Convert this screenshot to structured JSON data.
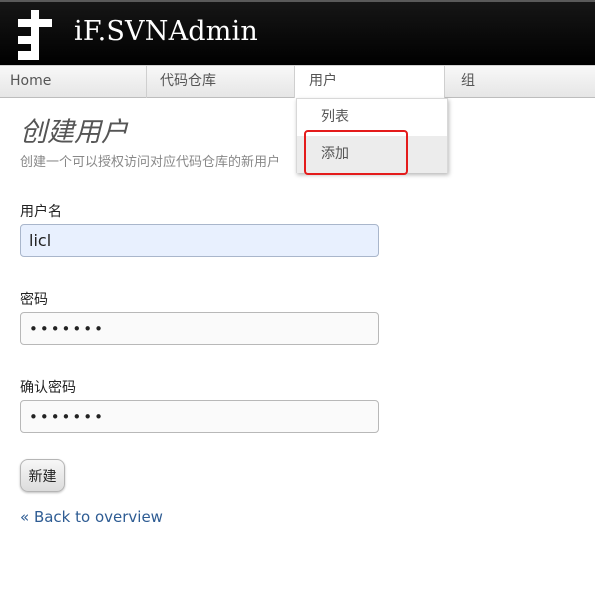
{
  "header": {
    "title": "iF.SVNAdmin",
    "logo": "svnadmin-logo-icon",
    "background": "#000000"
  },
  "nav": {
    "items": [
      {
        "label": "Home"
      },
      {
        "label": "代码仓库"
      },
      {
        "label": "用户"
      },
      {
        "label": "组"
      }
    ]
  },
  "dropdown": {
    "items": [
      {
        "label": "列表"
      },
      {
        "label": "添加"
      }
    ],
    "highlight_color": "#e41b1b"
  },
  "page": {
    "title": "创建用户",
    "description": "创建一个可以授权访问对应代码仓库的新用户"
  },
  "form": {
    "username_label": "用户名",
    "username_value": "licl",
    "password_label": "密码",
    "password_value": "1234567",
    "confirm_label": "确认密码",
    "confirm_value": "1234567",
    "submit_label": "新建"
  },
  "back_link": "« Back to overview"
}
